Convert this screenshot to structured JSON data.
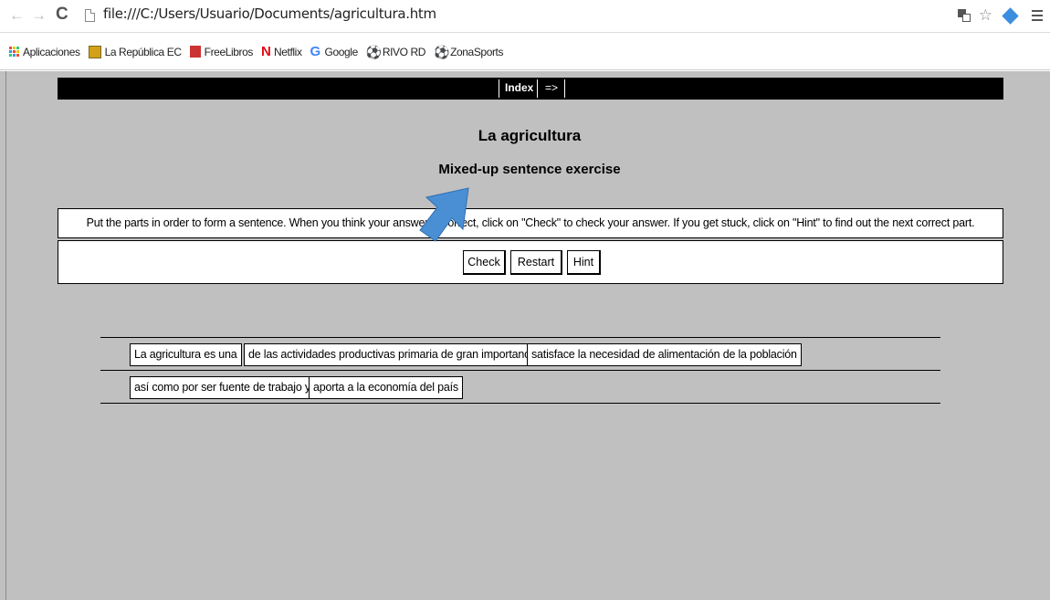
{
  "browser": {
    "url": "file:///C:/Users/Usuario/Documents/agricultura.htm",
    "icons": [
      "back-icon",
      "forward-icon",
      "reload-icon",
      "page-icon",
      "translate-icon",
      "star-icon",
      "extension-icon",
      "menu-icon"
    ]
  },
  "bookmarks": [
    {
      "label": "Aplicaciones",
      "icon": "apps-icon",
      "color": "#e74c3c"
    },
    {
      "label": "La República EC",
      "icon": "republica-icon",
      "color": "#d4a017"
    },
    {
      "label": "FreeLibros",
      "icon": "freelibros-icon",
      "color": "#cc3333"
    },
    {
      "label": "Netflix",
      "icon": "netflix-icon",
      "color": "#e50914"
    },
    {
      "label": "Google",
      "icon": "google-icon",
      "color": "#4285f4"
    },
    {
      "label": "RIVO RD",
      "icon": "soccer-ball-icon",
      "color": "#333333"
    },
    {
      "label": "ZonaSports",
      "icon": "soccer-ball-icon",
      "color": "#333333"
    }
  ],
  "page": {
    "nav": {
      "index_label": "Index",
      "next_label": "=>"
    },
    "title": "La agricultura",
    "subtitle": "Mixed-up sentence exercise",
    "instructions": "Put the parts in order to form a sentence. When you think your answer is correct, click on \"Check\" to check your answer. If you get stuck, click on \"Hint\" to find out the next correct part.",
    "buttons": {
      "check": "Check",
      "restart": "Restart",
      "hint": "Hint"
    },
    "parts": [
      "La agricultura es una",
      "de las actividades productivas primaria de gran importancia",
      "satisface la necesidad de alimentación de la población",
      "así como por ser fuente de trabajo y",
      "aporta a la economía del país"
    ]
  },
  "colors": {
    "page_bg": "#c0c0c0",
    "nav_bg": "#000000",
    "pointer": "#4a8fd4"
  }
}
